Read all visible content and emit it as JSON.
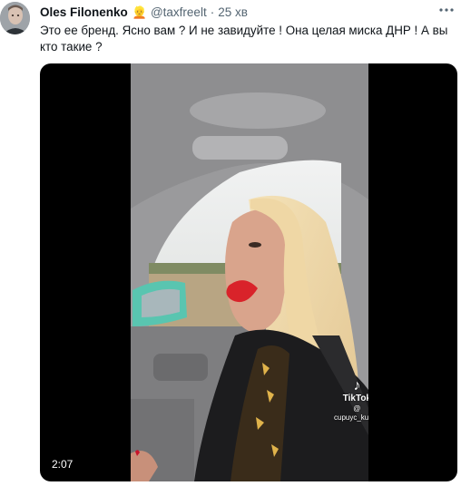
{
  "tweet": {
    "display_name": "Oles Filonenko",
    "verified_emoji": "👱",
    "handle": "@taxfreelt",
    "separator": "·",
    "time": "25 хв",
    "more_icon": "more-icon",
    "text": "Это ее бренд. Ясно вам ? И не завидуйте ! Она целая миска ДНР ! А вы кто такие ?"
  },
  "video": {
    "duration": "2:07",
    "watermark_brand": "TikTok",
    "watermark_user": "@ cupuyc_kupuli",
    "watermark_logo": "tiktok-note-icon"
  }
}
